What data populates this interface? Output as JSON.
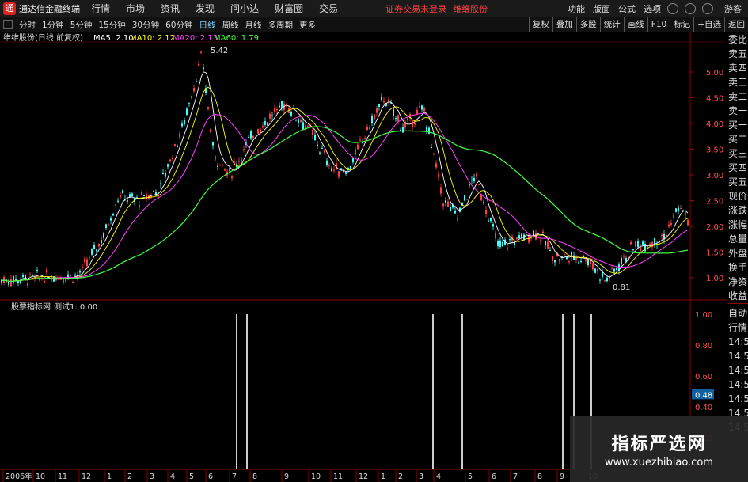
{
  "app": {
    "name": "通达信金融终端",
    "alert": "证券交易未登录",
    "stock_link": "维维股份"
  },
  "menu": [
    "行情",
    "市场",
    "资讯",
    "发现",
    "问小达",
    "财富圈",
    "交易"
  ],
  "topright": [
    "功能",
    "版面",
    "公式",
    "选项",
    "游客"
  ],
  "periods": [
    "分时",
    "1分钟",
    "5分钟",
    "15分钟",
    "30分钟",
    "60分钟",
    "日线",
    "周线",
    "月线",
    "多周期",
    "更多"
  ],
  "active_period": "日线",
  "rightbtns": [
    "复权",
    "叠加",
    "多股",
    "统计",
    "画线",
    "F10",
    "标记",
    "+自选",
    "返回"
  ],
  "main_header": {
    "stock": "维维股份(日线 前复权)",
    "ma5": "MA5: 2.10",
    "ma10": "MA10: 2.12",
    "ma20": "MA20: 2.13",
    "ma60": "MA60: 1.79",
    "high_label": "5.42",
    "low_label": "0.81"
  },
  "yaxis_main": [
    "5.00",
    "4.50",
    "4.00",
    "3.50",
    "3.00",
    "2.50",
    "2.00",
    "1.50",
    "1.00"
  ],
  "ind_header": {
    "name": "股票指标网",
    "value": "测试1: 0.00"
  },
  "yaxis_ind": [
    "1.00",
    "0.80",
    "0.60",
    "0.48",
    "0.40",
    "0.20"
  ],
  "ind_current": "0.48",
  "xaxis": [
    "2006年",
    "10",
    "11",
    "12",
    "1",
    "2",
    "3",
    "4",
    "5",
    "6",
    "7",
    "8",
    "9",
    "10",
    "11",
    "12",
    "1",
    "2",
    "3",
    "4",
    "5",
    "6",
    "7",
    "8",
    "9",
    "10"
  ],
  "side_panel": [
    "委比",
    "卖五",
    "卖四",
    "卖三",
    "卖二",
    "卖一",
    "买一",
    "买二",
    "买三",
    "买四",
    "买五",
    "现价",
    "涨跌",
    "涨幅",
    "总量",
    "外盘",
    "换手",
    "净资",
    "收益"
  ],
  "side_panel2": [
    "自动",
    "行情",
    "14:5",
    "14:5",
    "14:5",
    "14:5",
    "14:5",
    "14:5",
    "14:5"
  ],
  "watermark": {
    "title": "指标严选网",
    "url": "www.xuezhibiao.com"
  },
  "colors": {
    "ma5": "#ffffff",
    "ma10": "#ffff00",
    "ma20": "#ff40ff",
    "ma60": "#40ff40",
    "up": "#ff4040",
    "down": "#40ffff"
  }
}
